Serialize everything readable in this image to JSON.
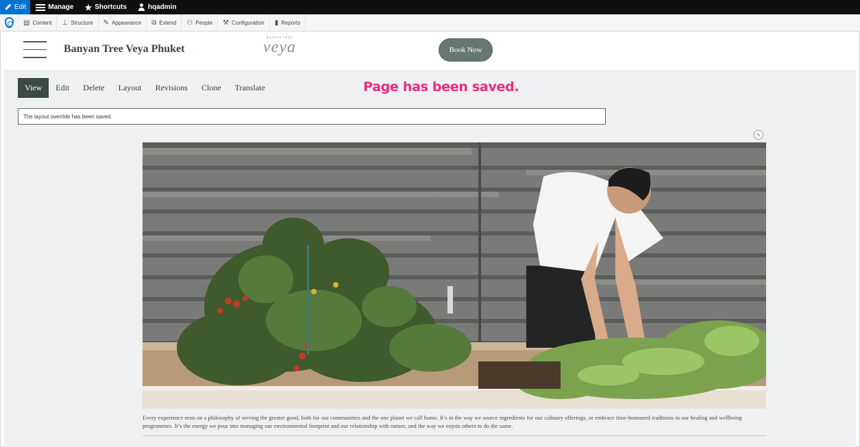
{
  "admin_toolbar": {
    "edit_label": "Edit",
    "manage_label": "Manage",
    "shortcuts_label": "Shortcuts",
    "user_label": "hqadmin"
  },
  "admin_tray": {
    "items": [
      {
        "label": "Content",
        "icon": "content-icon"
      },
      {
        "label": "Structure",
        "icon": "structure-icon"
      },
      {
        "label": "Appearance",
        "icon": "appearance-icon"
      },
      {
        "label": "Extend",
        "icon": "extend-icon"
      },
      {
        "label": "People",
        "icon": "people-icon"
      },
      {
        "label": "Configuration",
        "icon": "configuration-icon"
      },
      {
        "label": "Reports",
        "icon": "reports-icon"
      }
    ]
  },
  "site_header": {
    "site_name": "Banyan Tree Veya Phuket",
    "logo_small_text": "BANYAN TREE",
    "logo_text": "veya",
    "book_button": "Book Now"
  },
  "page_tabs": {
    "items": [
      "View",
      "Edit",
      "Delete",
      "Layout",
      "Revisions",
      "Clone",
      "Translate"
    ],
    "active": "View"
  },
  "annotation": "Page has been saved.",
  "status_message": "The layout override has been saved.",
  "caption": "Every experience rests on a philosophy of serving the greater good, both for our communities and the one planet we call home. It’s in the way we source ingredients for our culinary offerings, or embrace time-honoured traditions in our healing and wellbeing programmes. It’s the energy we pour into managing our environmental footprint and our relationship with nature, and the way we enjoin others to do the same.",
  "colors": {
    "admin_bar": "#0f0f0f",
    "edit_blue": "#0672cb",
    "book_button": "#677670",
    "active_tab": "#3a4a45",
    "annotation": "#ea2a7e",
    "content_bg": "#eef0f2"
  }
}
